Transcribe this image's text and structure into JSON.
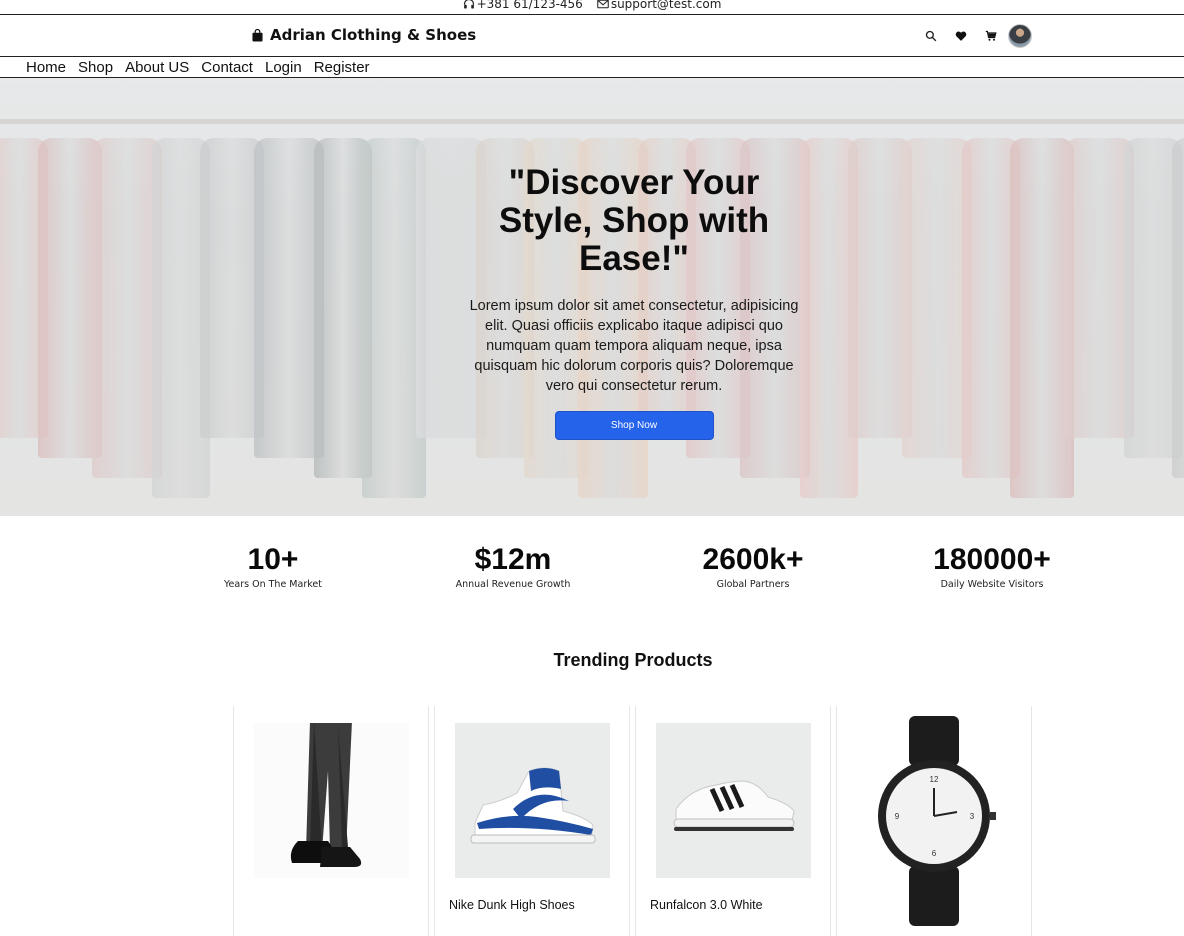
{
  "contact": {
    "phone": "+381 61/123-456",
    "email": "support@test.com"
  },
  "header": {
    "brand": "Adrian Clothing & Shoes",
    "icons": [
      "search-icon",
      "heart-icon",
      "cart-icon",
      "avatar"
    ]
  },
  "nav": {
    "items": [
      "Home",
      "Shop",
      "About US",
      "Contact",
      "Login",
      "Register"
    ]
  },
  "hero": {
    "title": "\"Discover Your Style, Shop with Ease!\"",
    "text": "Lorem ipsum dolor sit amet consectetur, adipisicing elit. Quasi officiis explicabo itaque adipisci quo numquam quam tempora aliquam neque, ipsa quisquam hic dolorum corporis quis? Doloremque vero qui consectetur rerum.",
    "button": "Shop Now"
  },
  "stats": [
    {
      "value": "10+",
      "label": "Years On The Market"
    },
    {
      "value": "$12m",
      "label": "Annual Revenue Growth"
    },
    {
      "value": "2600k+",
      "label": "Global Partners"
    },
    {
      "value": "180000+",
      "label": "Daily Website Visitors"
    }
  ],
  "trending": {
    "title": "Trending Products",
    "products": [
      {
        "name": ""
      },
      {
        "name": "Nike Dunk High Shoes"
      },
      {
        "name": "Runfalcon 3.0 White"
      },
      {
        "name": ""
      }
    ]
  },
  "colors": {
    "accent": "#2563eb"
  }
}
